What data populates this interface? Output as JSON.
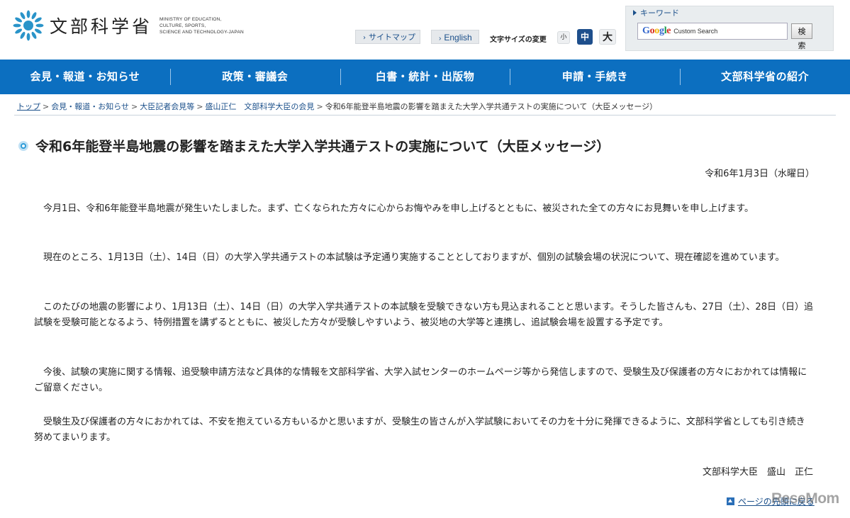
{
  "header": {
    "logo_jp": "文部科学省",
    "logo_en": [
      "MINISTRY OF EDUCATION,",
      "CULTURE, SPORTS,",
      "SCIENCE AND TECHNOLOGY-JAPAN"
    ],
    "sitemap_label": "サイトマップ",
    "english_label": "English",
    "font_size_label": "文字サイズの変更",
    "font_small": "小",
    "font_medium": "中",
    "font_large": "大",
    "search": {
      "label": "キーワード",
      "google": "Google",
      "placeholder": "Custom Search",
      "button": "検索"
    }
  },
  "nav": [
    {
      "label": "会見・報道・お知らせ"
    },
    {
      "label": "政策・審議会"
    },
    {
      "label": "白書・統計・出版物"
    },
    {
      "label": "申請・手続き"
    },
    {
      "label": "文部科学省の紹介"
    }
  ],
  "breadcrumb": {
    "home": "トップ",
    "items": [
      "会見・報道・お知らせ",
      "大臣記者会見等",
      "盛山正仁　文部科学大臣の会見"
    ],
    "current": "令和6年能登半島地震の影響を踏まえた大学入学共通テストの実施について（大臣メッセージ）"
  },
  "main": {
    "title": "令和6年能登半島地震の影響を踏まえた大学入学共通テストの実施について（大臣メッセージ）",
    "date": "令和6年1月3日（水曜日）",
    "paragraphs": [
      "　今月1日、令和6年能登半島地震が発生いたしました。まず、亡くなられた方々に心からお悔やみを申し上げるとともに、被災された全ての方々にお見舞いを申し上げます。",
      "　現在のところ、1月13日（土）、14日（日）の大学入学共通テストの本試験は予定通り実施することとしておりますが、個別の試験会場の状況について、現在確認を進めています。",
      "　このたびの地震の影響により、1月13日（土）、14日（日）の大学入学共通テストの本試験を受験できない方も見込まれることと思います。そうした皆さんも、27日（土）、28日（日）追試験を受験可能となるよう、特例措置を講ずるとともに、被災した方々が受験しやすいよう、被災地の大学等と連携し、追試験会場を設置する予定です。",
      "　今後、試験の実施に関する情報、追受験申請方法など具体的な情報を文部科学省、大学入試センターのホームページ等から発信しますので、受験生及び保護者の方々におかれては情報にご留意ください。",
      "　受験生及び保護者の方々におかれては、不安を抱えている方もいるかと思いますが、受験生の皆さんが入学試験においてその力を十分に発揮できるように、文部科学省としても引き続き努めてまいります。"
    ],
    "signature": "文部科学大臣　盛山　正仁",
    "page_top": "ページの先頭に戻る"
  },
  "watermark": "ReseMom",
  "colors": {
    "nav_bg": "#0c6fc0",
    "link": "#1a4f8a",
    "title_dot": "#2c9bd8"
  }
}
